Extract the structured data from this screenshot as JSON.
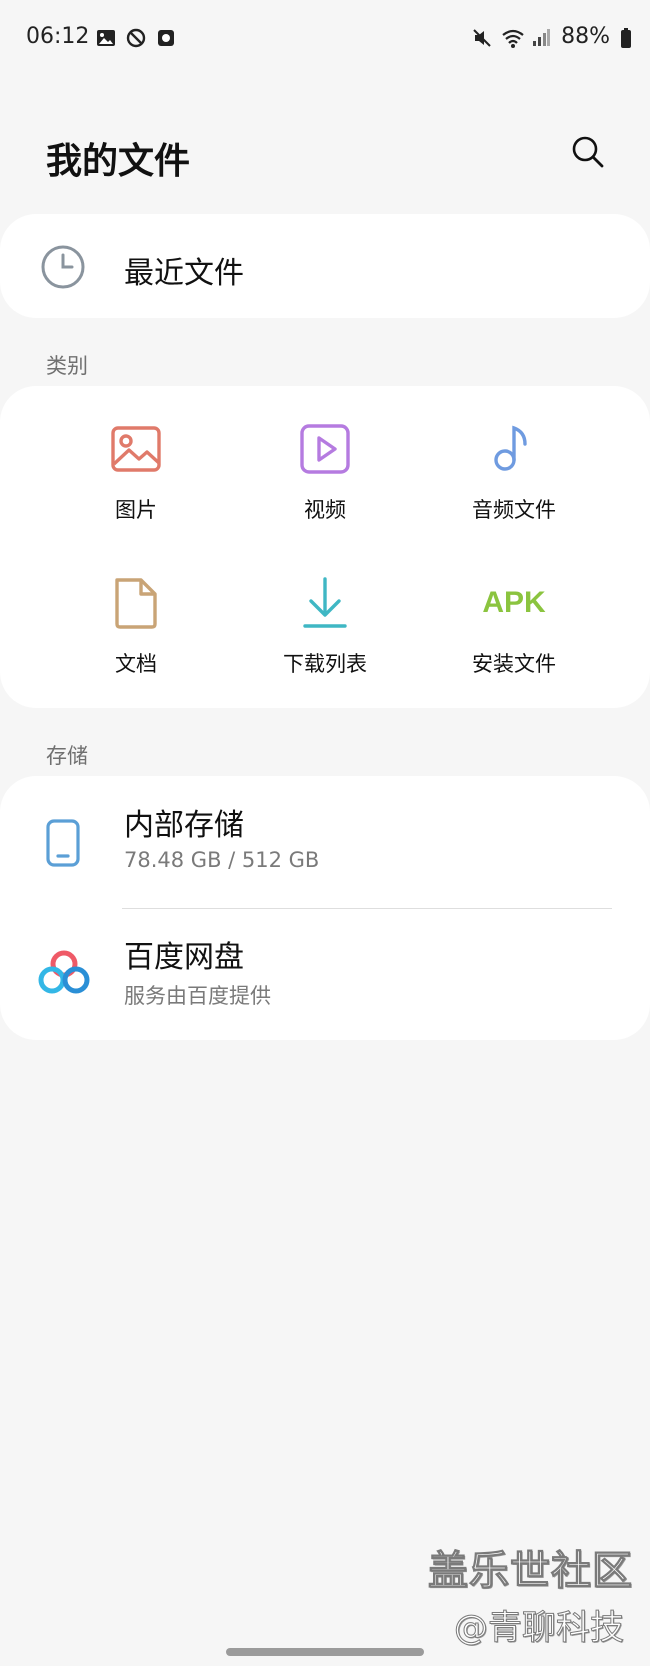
{
  "status_bar": {
    "time": "06:12",
    "battery": "88%",
    "left_icons": [
      "gallery-icon",
      "blocked-icon",
      "record-icon"
    ],
    "right_icons": [
      "mute-icon",
      "wifi-icon",
      "signal-icon",
      "battery-icon"
    ]
  },
  "header": {
    "title": "我的文件",
    "search_icon": "search-icon"
  },
  "recent": {
    "label": "最近文件",
    "icon": "clock-icon"
  },
  "categories": {
    "section_label": "类别",
    "items": [
      {
        "label": "图片",
        "icon": "image-icon",
        "color": "#e07a6a"
      },
      {
        "label": "视频",
        "icon": "video-icon",
        "color": "#b57be0"
      },
      {
        "label": "音频文件",
        "icon": "music-note-icon",
        "color": "#6f9be0"
      },
      {
        "label": "文档",
        "icon": "document-icon",
        "color": "#c9a476"
      },
      {
        "label": "下载列表",
        "icon": "download-icon",
        "color": "#3fb7c4"
      },
      {
        "label": "安装文件",
        "icon": "apk-icon",
        "icon_text": "APK",
        "color": "#8bc43f"
      }
    ]
  },
  "storage": {
    "section_label": "存储",
    "items": [
      {
        "title": "内部存储",
        "subtitle": "78.48 GB / 512 GB",
        "icon": "phone-icon",
        "color": "#5b9fd6"
      },
      {
        "title": "百度网盘",
        "subtitle": "服务由百度提供",
        "icon": "baidu-cloud-icon"
      }
    ]
  },
  "watermark": {
    "text": "盖乐世社区",
    "subtext": "@青聊科技"
  }
}
